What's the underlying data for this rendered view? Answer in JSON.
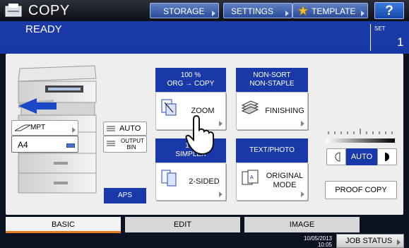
{
  "title_bar": {
    "title": "COPY",
    "storage_label": "STORAGE",
    "settings_label": "SETTINGS",
    "template_label": "TEMPLATE",
    "help_label": "?"
  },
  "status": {
    "text": "READY",
    "set_label": "SET",
    "set_count": "1"
  },
  "machine": {
    "mpt_label": "MPT",
    "paper_size": "A4",
    "auto_label": "AUTO",
    "output_bin_label": "OUTPUT BIN",
    "aps_label": "APS"
  },
  "functions": {
    "zoom_header_line1": "100 %",
    "zoom_header_line2": "ORG → COPY",
    "zoom_label": "ZOOM",
    "finishing_header_line1": "NON-SORT",
    "finishing_header_line2": "NON-STAPLE",
    "finishing_label": "FINISHING",
    "sided_header_line1": "1→",
    "sided_header_line2": "SIMPLEX",
    "sided_label": "2-SIDED",
    "mode_header": "TEXT/PHOTO",
    "mode_label_line1": "ORIGINAL",
    "mode_label_line2": "MODE"
  },
  "density": {
    "auto_label": "AUTO",
    "level": 0.5
  },
  "proof_copy_label": "PROOF COPY",
  "tabs": {
    "basic": "BASIC",
    "edit": "EDIT",
    "image": "IMAGE",
    "active": "basic"
  },
  "footer": {
    "date": "10/05/2013",
    "time": "10:05",
    "job_status_label": "JOB STATUS"
  },
  "colors": {
    "accent": "#1a39a8",
    "status_bar": "#1a3aa8",
    "active_tab_underline": "#e87a1a"
  }
}
